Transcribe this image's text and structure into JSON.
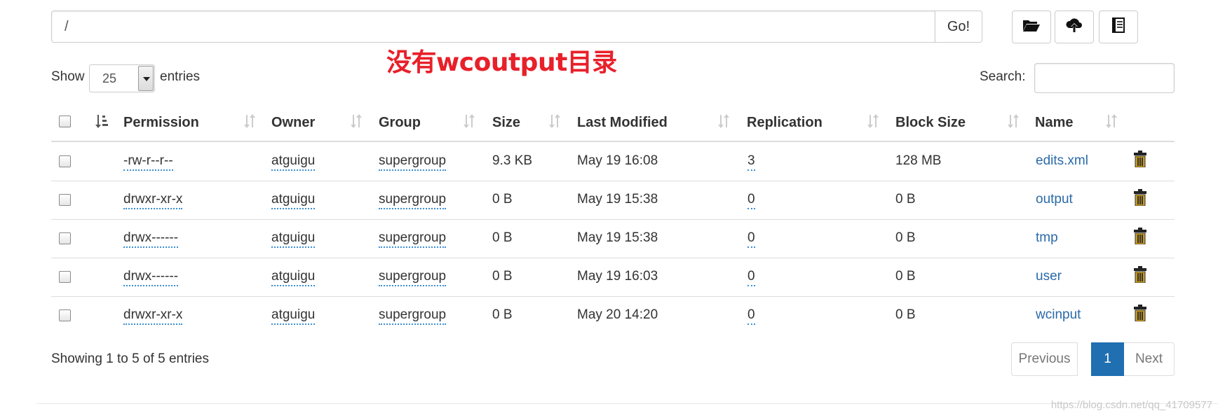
{
  "path_bar": {
    "value": "/",
    "go_label": "Go!"
  },
  "toolbar": {
    "icons": [
      "folder-open-icon",
      "cloud-upload-icon",
      "book-icon"
    ]
  },
  "annotation": "没有wcoutput目录",
  "length": {
    "show_label": "Show",
    "value": "25",
    "entries_label": "entries"
  },
  "search": {
    "label": "Search:",
    "value": ""
  },
  "table": {
    "columns": [
      "Permission",
      "Owner",
      "Group",
      "Size",
      "Last Modified",
      "Replication",
      "Block Size",
      "Name"
    ],
    "rows": [
      {
        "permission": "-rw-r--r--",
        "owner": "atguigu",
        "group": "supergroup",
        "size": "9.3 KB",
        "modified": "May 19 16:08",
        "replication": "3",
        "block_size": "128 MB",
        "name": "edits.xml"
      },
      {
        "permission": "drwxr-xr-x",
        "owner": "atguigu",
        "group": "supergroup",
        "size": "0 B",
        "modified": "May 19 15:38",
        "replication": "0",
        "block_size": "0 B",
        "name": "output"
      },
      {
        "permission": "drwx------",
        "owner": "atguigu",
        "group": "supergroup",
        "size": "0 B",
        "modified": "May 19 15:38",
        "replication": "0",
        "block_size": "0 B",
        "name": "tmp"
      },
      {
        "permission": "drwx------",
        "owner": "atguigu",
        "group": "supergroup",
        "size": "0 B",
        "modified": "May 19 16:03",
        "replication": "0",
        "block_size": "0 B",
        "name": "user"
      },
      {
        "permission": "drwxr-xr-x",
        "owner": "atguigu",
        "group": "supergroup",
        "size": "0 B",
        "modified": "May 20 14:20",
        "replication": "0",
        "block_size": "0 B",
        "name": "wcinput"
      }
    ]
  },
  "info": "Showing 1 to 5 of 5 entries",
  "pagination": {
    "previous": "Previous",
    "current": "1",
    "next": "Next"
  },
  "colors": {
    "accent": "#1f6fb1",
    "link": "#2a6aa8",
    "annotation": "#e8202a",
    "trash": "#c99a1c"
  },
  "watermark": "https://blog.csdn.net/qq_41709577"
}
